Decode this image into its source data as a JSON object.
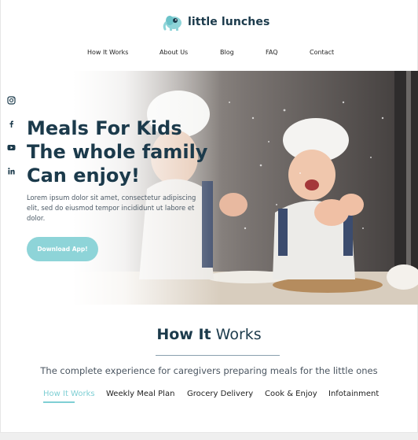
{
  "brand": {
    "name": "little lunches",
    "accent": "#8ed4d8",
    "dark": "#1b3a4b"
  },
  "nav": {
    "items": [
      {
        "label": "How It Works"
      },
      {
        "label": "About Us"
      },
      {
        "label": "Blog"
      },
      {
        "label": "FAQ"
      },
      {
        "label": "Contact"
      }
    ]
  },
  "social": [
    "instagram-icon",
    "facebook-icon",
    "youtube-icon",
    "linkedin-icon"
  ],
  "hero": {
    "title_lines": [
      "Meals For Kids",
      "The whole family",
      "Can enjoy!"
    ],
    "subtitle": "Lorem ipsum dolor sit amet, consectetur adipiscing elit, sed do eiusmod tempor incididunt ut labore et dolor.",
    "cta_label": "Download App!"
  },
  "how_it_works": {
    "title_bold": "How It",
    "title_light": "Works",
    "subtitle": "The complete experience for caregivers preparing meals for the little ones",
    "tabs": [
      {
        "label": "How It Works",
        "active": true
      },
      {
        "label": "Weekly Meal Plan",
        "active": false
      },
      {
        "label": "Grocery Delivery",
        "active": false
      },
      {
        "label": "Cook & Enjoy",
        "active": false
      },
      {
        "label": "Infotainment",
        "active": false
      }
    ]
  }
}
